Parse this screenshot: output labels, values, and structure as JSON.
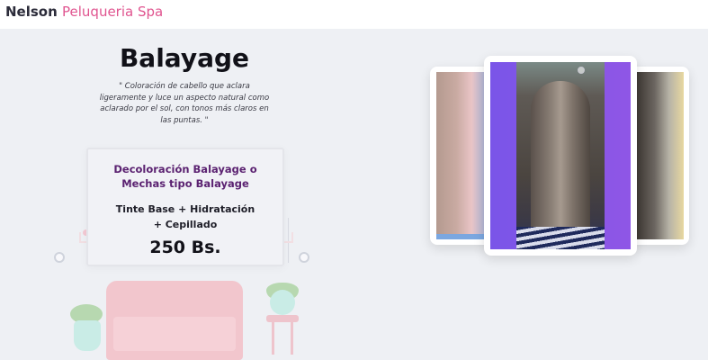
{
  "header": {
    "brand_part1": "Nelson",
    "brand_part2": "Peluqueria Spa"
  },
  "service": {
    "title": "Balayage",
    "description": "\" Coloración de cabello que aclara ligeramente y luce un aspecto natural como aclarado por el sol, con tonos más claros en las puntas. \""
  },
  "card": {
    "title": "Decoloración Balayage o Mechas tipo Balayage",
    "includes": "Tinte Base + Hidratación + Cepillado",
    "price": "250 Bs."
  },
  "colors": {
    "brand_accent": "#e0548f",
    "card_title": "#5b2271",
    "photo_frame_accent": "#8f56e6"
  }
}
